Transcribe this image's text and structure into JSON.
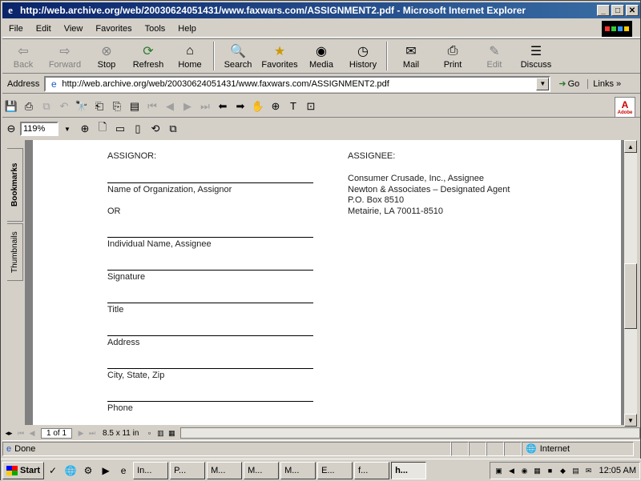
{
  "window": {
    "title": "http://web.archive.org/web/20030624051431/www.faxwars.com/ASSIGNMENT2.pdf - Microsoft Internet Explorer"
  },
  "menu": [
    "File",
    "Edit",
    "View",
    "Favorites",
    "Tools",
    "Help"
  ],
  "toolbar": {
    "back": "Back",
    "forward": "Forward",
    "stop": "Stop",
    "refresh": "Refresh",
    "home": "Home",
    "search": "Search",
    "favorites": "Favorites",
    "media": "Media",
    "history": "History",
    "mail": "Mail",
    "print": "Print",
    "edit": "Edit",
    "discuss": "Discuss"
  },
  "address": {
    "label": "Address",
    "url": "http://web.archive.org/web/20030624051431/www.faxwars.com/ASSIGNMENT2.pdf",
    "go": "Go",
    "links": "Links"
  },
  "acrobat": {
    "zoom": "119%",
    "logo": "Adobe"
  },
  "nav_tabs": {
    "bookmarks": "Bookmarks",
    "thumbnails": "Thumbnails"
  },
  "document": {
    "assignor_heading": "ASSIGNOR:",
    "assignee_heading": "ASSIGNEE:",
    "assignee_lines": [
      "Consumer Crusade, Inc., Assignee",
      "Newton & Associates – Designated Agent",
      "P.O. Box 8510",
      "Metairie, LA  70011-8510"
    ],
    "field_org": "Name of Organization, Assignor",
    "or": "OR",
    "field_individual": "Individual Name, Assignee",
    "field_signature": "Signature",
    "field_title": "Title",
    "field_address": "Address",
    "field_city": "City, State, Zip",
    "field_phone": "Phone"
  },
  "pdf_status": {
    "page": "1 of 1",
    "size": "8.5 x 11 in"
  },
  "status": {
    "text": "Done",
    "zone": "Internet"
  },
  "taskbar": {
    "start": "Start",
    "tasks": [
      "In...",
      "P...",
      "M...",
      "M...",
      "M...",
      "E...",
      "f...",
      "h..."
    ],
    "clock": "12:05 AM"
  }
}
